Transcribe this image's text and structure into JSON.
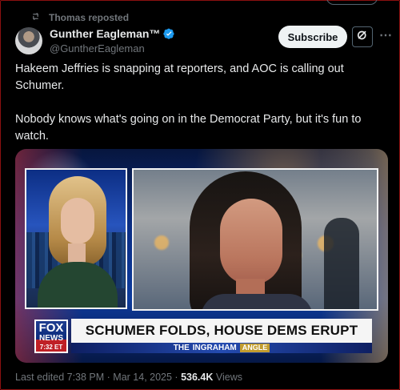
{
  "repost": {
    "text": "Thomas reposted"
  },
  "author": {
    "name": "Gunther Eagleman™",
    "handle": "@GuntherEagleman",
    "subscribe_label": "Subscribe"
  },
  "tweet": {
    "line1": "Hakeem Jeffries is snapping at reporters, and AOC is calling out Schumer.",
    "line2": "Nobody knows what's going on in the Democrat Party, but it's fun to watch."
  },
  "media": {
    "network_top": "FOX",
    "network_bottom": "NEWS",
    "time": "7:32 ET",
    "headline": "SCHUMER FOLDS, HOUSE DEMS ERUPT",
    "show_title_prefix": "THE",
    "show_title": "INGRAHAM",
    "show_tag": "ANGLE"
  },
  "footer": {
    "edited_text": "Last edited 7:38 PM · Mar 14, 2025 ·",
    "views_count": "536.4K",
    "views_label": "Views"
  },
  "colors": {
    "accent": "#1d9bf0",
    "muted": "#71767b",
    "text": "#e7e9ea",
    "fox_red": "#bf2026",
    "fox_blue": "#0b2b7c"
  },
  "icons": {
    "repost": "repost-icon",
    "verified": "verified-icon",
    "grok": "grok-icon",
    "more": "more-icon"
  }
}
